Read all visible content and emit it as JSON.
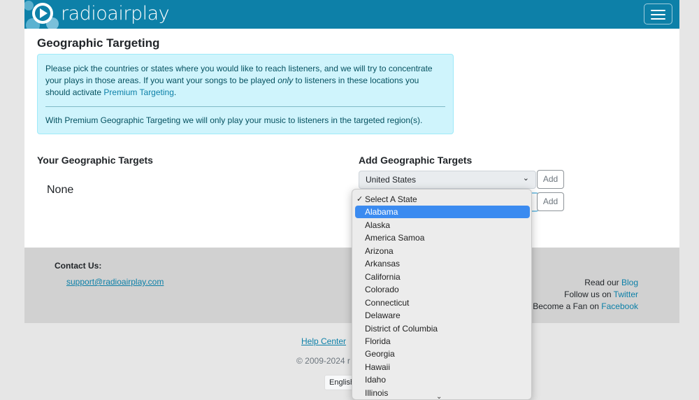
{
  "header": {
    "logo_text": "radioairplay",
    "menu_icon": "hamburger-icon"
  },
  "page": {
    "title": "Geographic Targeting",
    "info_line1_pre": "Please pick the countries or states where you would like to reach listeners, and we will try to concentrate your plays in those areas. If you want your songs to be played ",
    "info_only": "only",
    "info_line1_post": " to listeners in these locations you should activate ",
    "info_link": "Premium Targeting",
    "info_line1_end": ".",
    "info_line2": "With Premium Geographic Targeting we will only play your music to listeners in the targeted region(s)."
  },
  "targets": {
    "your_heading": "Your Geographic Targets",
    "your_value": "None",
    "add_heading": "Add Geographic Targets",
    "country_select": "United States",
    "add_label_1": "Add",
    "add_label_2": "Add"
  },
  "state_dropdown": {
    "options": [
      {
        "label": "Select A State",
        "checked": true,
        "highlighted": false
      },
      {
        "label": "Alabama",
        "checked": false,
        "highlighted": true
      },
      {
        "label": "Alaska",
        "checked": false,
        "highlighted": false
      },
      {
        "label": "America Samoa",
        "checked": false,
        "highlighted": false
      },
      {
        "label": "Arizona",
        "checked": false,
        "highlighted": false
      },
      {
        "label": "Arkansas",
        "checked": false,
        "highlighted": false
      },
      {
        "label": "California",
        "checked": false,
        "highlighted": false
      },
      {
        "label": "Colorado",
        "checked": false,
        "highlighted": false
      },
      {
        "label": "Connecticut",
        "checked": false,
        "highlighted": false
      },
      {
        "label": "Delaware",
        "checked": false,
        "highlighted": false
      },
      {
        "label": "District of Columbia",
        "checked": false,
        "highlighted": false
      },
      {
        "label": "Florida",
        "checked": false,
        "highlighted": false
      },
      {
        "label": "Georgia",
        "checked": false,
        "highlighted": false
      },
      {
        "label": "Hawaii",
        "checked": false,
        "highlighted": false
      },
      {
        "label": "Idaho",
        "checked": false,
        "highlighted": false
      },
      {
        "label": "Illinois",
        "checked": false,
        "highlighted": false
      }
    ],
    "scroll_icon": "chevron-down-icon"
  },
  "footer": {
    "contact_label": "Contact Us:",
    "contact_email": "support@radioairplay.com",
    "blog_pre": "Read our ",
    "blog_link": "Blog",
    "twitter_pre": "Follow us on ",
    "twitter_link": "Twitter",
    "facebook_pre": "Become a Fan on ",
    "facebook_link": "Facebook",
    "help_link": "Help Center",
    "copyright": "© 2009-2024 r",
    "language": "English"
  },
  "colors": {
    "brand": "#0d80a8",
    "info_bg": "#cff4fc",
    "selection": "#3b8bf0"
  }
}
